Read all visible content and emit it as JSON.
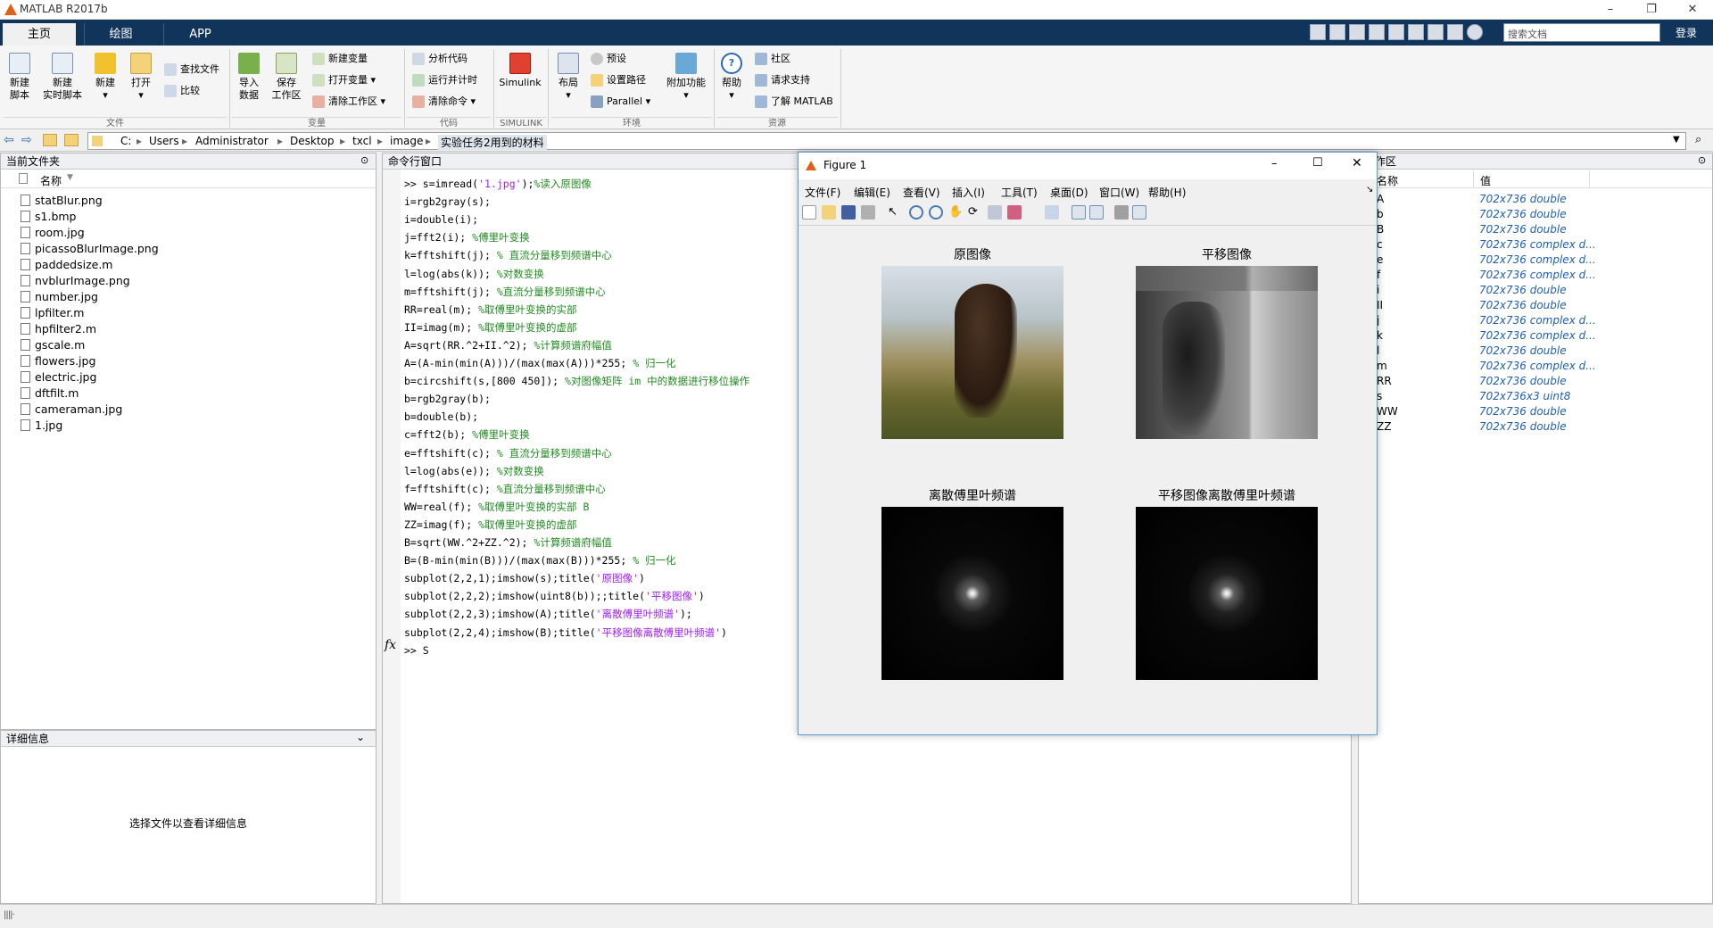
{
  "app": {
    "title": "MATLAB R2017b"
  },
  "tabs": [
    "主页",
    "绘图",
    "APP"
  ],
  "quick": {
    "search_placeholder": "搜索文档",
    "login": "登录"
  },
  "ribbon": {
    "new_script": "新建\n脚本",
    "new_live": "新建\n实时脚本",
    "new": "新建",
    "open": "打开",
    "find_files": "查找文件",
    "compare": "比较",
    "import": "导入\n数据",
    "save_ws": "保存\n工作区",
    "new_var": "新建变量",
    "open_var": "打开变量",
    "clear_ws": "清除工作区",
    "analyze": "分析代码",
    "run_time": "运行并计时",
    "clear_cmd": "清除命令",
    "simulink": "Simulink",
    "layout": "布局",
    "prefs": "预设",
    "set_path": "设置路径",
    "parallel": "Parallel",
    "addons": "附加功能",
    "help": "帮助",
    "community": "社区",
    "support": "请求支持",
    "learn": "了解 MATLAB",
    "groups": [
      "文件",
      "变量",
      "代码",
      "SIMULINK",
      "环境",
      "资源"
    ]
  },
  "address": [
    "C:",
    "Users",
    "Administrator",
    "Desktop",
    "txcl",
    "image",
    "实验任务2用到的材料"
  ],
  "current_folder": {
    "title": "当前文件夹",
    "col": "名称",
    "files": [
      "statBlur.png",
      "s1.bmp",
      "room.jpg",
      "picassoBlurImage.png",
      "paddedsize.m",
      "nvblurImage.png",
      "number.jpg",
      "lpfilter.m",
      "hpfilter2.m",
      "gscale.m",
      "flowers.jpg",
      "electric.jpg",
      "dftfilt.m",
      "cameraman.jpg",
      "1.jpg"
    ]
  },
  "details": {
    "title": "详细信息",
    "hint": "选择文件以查看详细信息"
  },
  "command_window": {
    "title": "命令行窗口",
    "lines": [
      {
        "code": ">> s=imread(",
        "str": "'1.jpg'",
        "rest": ");",
        "cm": "%读入原图像"
      },
      {
        "code": "i=rgb2gray(s);",
        "str": "",
        "rest": "",
        "cm": ""
      },
      {
        "code": "i=double(i);",
        "str": "",
        "rest": "",
        "cm": ""
      },
      {
        "code": "j=fft2(i); ",
        "str": "",
        "rest": "",
        "cm": "%傅里叶变换"
      },
      {
        "code": "k=fftshift(j); ",
        "str": "",
        "rest": "",
        "cm": "% 直流分量移到频谱中心"
      },
      {
        "code": "l=log(abs(k)); ",
        "str": "",
        "rest": "",
        "cm": "%对数变换"
      },
      {
        "code": "m=fftshift(j); ",
        "str": "",
        "rest": "",
        "cm": "%直流分量移到频谱中心"
      },
      {
        "code": "RR=real(m); ",
        "str": "",
        "rest": "",
        "cm": "%取傅里叶变换的实部"
      },
      {
        "code": "II=imag(m); ",
        "str": "",
        "rest": "",
        "cm": "%取傅里叶变换的虚部"
      },
      {
        "code": "A=sqrt(RR.^2+II.^2); ",
        "str": "",
        "rest": "",
        "cm": "%计算频谱府幅值"
      },
      {
        "code": "A=(A-min(min(A)))/(max(max(A)))*255; ",
        "str": "",
        "rest": "",
        "cm": "% 归一化"
      },
      {
        "code": "b=circshift(s,[800 450]); ",
        "str": "",
        "rest": "",
        "cm": "%对图像矩阵 im 中的数据进行移位操作"
      },
      {
        "code": "b=rgb2gray(b);",
        "str": "",
        "rest": "",
        "cm": ""
      },
      {
        "code": "b=double(b);",
        "str": "",
        "rest": "",
        "cm": ""
      },
      {
        "code": "c=fft2(b); ",
        "str": "",
        "rest": "",
        "cm": "%傅里叶变换"
      },
      {
        "code": "e=fftshift(c); ",
        "str": "",
        "rest": "",
        "cm": "% 直流分量移到频谱中心"
      },
      {
        "code": "l=log(abs(e)); ",
        "str": "",
        "rest": "",
        "cm": "%对数变换"
      },
      {
        "code": "f=fftshift(c); ",
        "str": "",
        "rest": "",
        "cm": "%直流分量移到频谱中心"
      },
      {
        "code": "WW=real(f); ",
        "str": "",
        "rest": "",
        "cm": "%取傅里叶变换的实部 B"
      },
      {
        "code": "ZZ=imag(f); ",
        "str": "",
        "rest": "",
        "cm": "%取傅里叶变换的虚部"
      },
      {
        "code": "B=sqrt(WW.^2+ZZ.^2); ",
        "str": "",
        "rest": "",
        "cm": "%计算频谱府幅值"
      },
      {
        "code": "B=(B-min(min(B)))/(max(max(B)))*255; ",
        "str": "",
        "rest": "",
        "cm": "% 归一化"
      },
      {
        "code": "subplot(2,2,1);imshow(s);title(",
        "str": "'原图像'",
        "rest": ")",
        "cm": ""
      },
      {
        "code": "subplot(2,2,2);imshow(uint8(b));;title(",
        "str": "'平移图像'",
        "rest": ")",
        "cm": ""
      },
      {
        "code": "subplot(2,2,3);imshow(A);title(",
        "str": "'离散傅里叶频谱'",
        "rest": ");",
        "cm": ""
      },
      {
        "code": "subplot(2,2,4);imshow(B);title(",
        "str": "'平移图像离散傅里叶频谱'",
        "rest": ")",
        "cm": ""
      },
      {
        "code": ">> S",
        "str": "",
        "rest": "",
        "cm": ""
      }
    ]
  },
  "workspace": {
    "title": "工作区",
    "col_name": "名称",
    "col_value": "值",
    "rows": [
      {
        "n": "A",
        "v": "702x736 double"
      },
      {
        "n": "b",
        "v": "702x736 double"
      },
      {
        "n": "B",
        "v": "702x736 double"
      },
      {
        "n": "c",
        "v": "702x736 complex d..."
      },
      {
        "n": "e",
        "v": "702x736 complex d..."
      },
      {
        "n": "f",
        "v": "702x736 complex d..."
      },
      {
        "n": "i",
        "v": "702x736 double"
      },
      {
        "n": "II",
        "v": "702x736 double"
      },
      {
        "n": "j",
        "v": "702x736 complex d..."
      },
      {
        "n": "k",
        "v": "702x736 complex d..."
      },
      {
        "n": "l",
        "v": "702x736 double"
      },
      {
        "n": "m",
        "v": "702x736 complex d..."
      },
      {
        "n": "RR",
        "v": "702x736 double"
      },
      {
        "n": "s",
        "v": "702x736x3 uint8"
      },
      {
        "n": "WW",
        "v": "702x736 double"
      },
      {
        "n": "ZZ",
        "v": "702x736 double"
      }
    ]
  },
  "figure": {
    "title": "Figure 1",
    "menu": [
      "文件(F)",
      "编辑(E)",
      "查看(V)",
      "插入(I)",
      "工具(T)",
      "桌面(D)",
      "窗口(W)",
      "帮助(H)"
    ],
    "titles": [
      "原图像",
      "平移图像",
      "离散傅里叶频谱",
      "平移图像离散傅里叶频谱"
    ]
  },
  "colors": {
    "accent": "#11345b",
    "comment": "#228b22",
    "string": "#a020f0",
    "ws_value": "#1f5fb0"
  }
}
